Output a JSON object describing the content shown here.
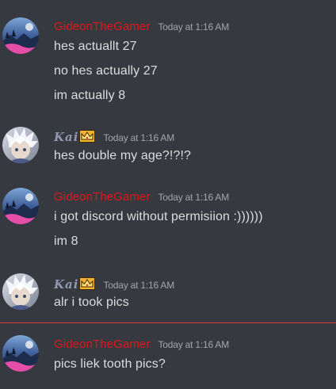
{
  "colors": {
    "background": "#36393f",
    "gideon_name": "#e0161a",
    "kai_name": "#8e9aaf",
    "message_text": "#dcddde",
    "timestamp_text": "#a3a6aa",
    "new_divider": "#d83c3e"
  },
  "groups": [
    {
      "username": "GideonTheGamer",
      "timestamp": "Today at 1:16 AM",
      "avatar": "gideon-avatar",
      "messages": [
        "hes actuallt 27",
        "no hes actually 27",
        "im actually 8"
      ]
    },
    {
      "username": "Kai",
      "badge_icon": "crown-icon",
      "timestamp": "Today at 1:16 AM",
      "avatar": "kai-avatar",
      "messages": [
        "hes double my age?!?!?"
      ]
    },
    {
      "username": "GideonTheGamer",
      "timestamp": "Today at 1:16 AM",
      "avatar": "gideon-avatar",
      "messages": [
        "i got discord without permisiion :))))))",
        "im 8"
      ]
    },
    {
      "username": "Kai",
      "badge_icon": "crown-icon",
      "timestamp": "Today at 1:16 AM",
      "avatar": "kai-avatar",
      "messages": [
        "alr i took pics"
      ]
    },
    {
      "username": "GideonTheGamer",
      "timestamp": "Today at 1:16 AM",
      "avatar": "gideon-avatar",
      "messages": [
        "pics liek tooth pics?"
      ]
    }
  ]
}
